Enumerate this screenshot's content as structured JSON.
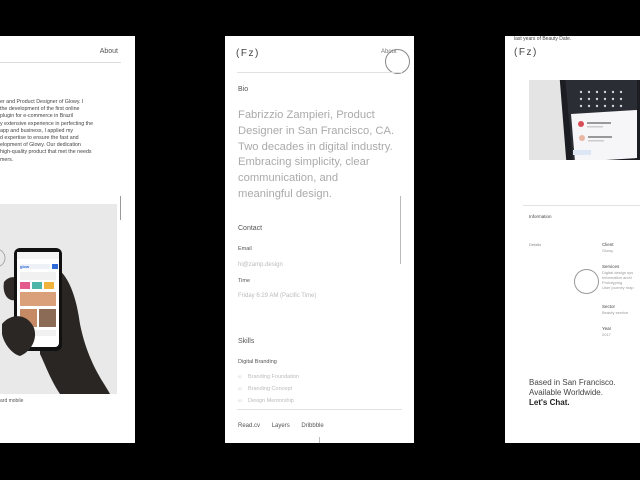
{
  "left_page": {
    "about_link": "About",
    "bio_lines": [
      "er and Product Designer of Glowy. I",
      "the development of the first online",
      "plugin for e-commerce in Brazil",
      "y extensive experience in perfecting the",
      "app and business, I applied my",
      "d expertise to ensure the fast and",
      "elopment of Glowy. Our dedication",
      "high-quality product that met the needs",
      "mers."
    ],
    "phone_brand": "glow",
    "caption": "ard mobile"
  },
  "middle_page": {
    "logo": "(Fz)",
    "about_link": "About",
    "bio_label": "Bio",
    "bio_lines": [
      "Fabrizzio Zampieri, Product",
      "Designer in San Francisco, CA.",
      "Two decades in digital industry.",
      "Embracing simplicity, clear",
      "communication, and",
      "meaningful design."
    ],
    "contact_label": "Contact",
    "email_label": "Email",
    "email_value": "hi@zamp.design",
    "time_label": "Time",
    "time_value": "Friday 6:29 AM (Pacific Time)",
    "skills_label": "Skills",
    "skills_group": "Digital Branding",
    "skills": [
      {
        "num": "01",
        "name": "Branding Foundation"
      },
      {
        "num": "02",
        "name": "Branding Concept"
      },
      {
        "num": "03",
        "name": "Design Mentorship"
      }
    ],
    "links": [
      "Read.cv",
      "Layers",
      "Dribbble"
    ]
  },
  "right_page": {
    "top_text": "last years of Beauty Date.",
    "logo": "(Fz)",
    "information_label": "Information",
    "details_label": "Details",
    "client_label": "Client",
    "client_value": "Glowy",
    "services_label": "Services",
    "services_values": [
      "Digital design sys",
      "Information archi",
      "Prototyping",
      "User journey map"
    ],
    "sector_label": "Sector",
    "sector_value": "Beauty service",
    "year_label": "Year",
    "year_value": "2017",
    "based_line1": "Based in San Francisco.",
    "based_line2": "Available Worldwide.",
    "chat_cta": "Let's Chat."
  },
  "colors": {
    "background": "#000000",
    "card": "#ffffff",
    "accent_blue": "#2f6bd8",
    "muted_text": "#aaaaaa"
  }
}
